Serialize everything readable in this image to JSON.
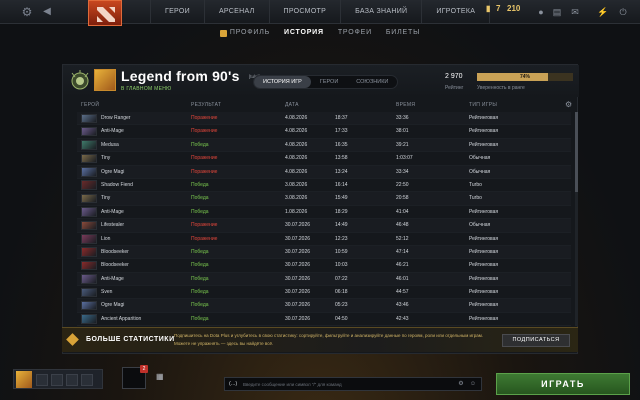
{
  "topbar": {
    "nav": [
      "ГЕРОИ",
      "АРСЕНАЛ",
      "ПРОСМОТР",
      "БАЗА ЗНАНИЙ",
      "ИГРОТЕКА"
    ],
    "shards": "7",
    "gold": "210"
  },
  "subtabs": [
    "ПРОФИЛЬ",
    "ИСТОРИЯ",
    "ТРОФЕИ",
    "БИЛЕТЫ"
  ],
  "profile": {
    "name": "Legend from 90's",
    "tag": "[tulpl]",
    "status": "В ГЛАВНОМ МЕНЮ",
    "tabs": [
      "ИСТОРИЯ ИГР",
      "ГЕРОИ",
      "СОЮЗНИКИ"
    ],
    "rating_value": "2 970",
    "rating_label": "Рейтинг",
    "confidence_pct": "74%",
    "confidence_value": 0.74,
    "confidence_label": "Уверенность в ранге"
  },
  "columns": [
    "ГЕРОЙ",
    "РЕЗУЛЬТАТ",
    "ДАТА",
    "ВРЕМЯ",
    "ТИП ИГРЫ"
  ],
  "matches": [
    {
      "hero": "Drow Ranger",
      "result": "Поражение",
      "win": false,
      "date": "4.08.2026",
      "time": "18:37",
      "duration": "33:36",
      "type": "Рейтинговая",
      "color": "#5b6f8a"
    },
    {
      "hero": "Anti-Mage",
      "result": "Поражение",
      "win": false,
      "date": "4.08.2026",
      "time": "17:33",
      "duration": "38:01",
      "type": "Рейтинговая",
      "color": "#6a5a8a"
    },
    {
      "hero": "Medusa",
      "result": "Победа",
      "win": true,
      "date": "4.08.2026",
      "time": "16:35",
      "duration": "39:21",
      "type": "Рейтинговая",
      "color": "#3f7a6a"
    },
    {
      "hero": "Tiny",
      "result": "Поражение",
      "win": false,
      "date": "4.08.2026",
      "time": "13:58",
      "duration": "1:03:07",
      "type": "Обычная",
      "color": "#7a6a4a"
    },
    {
      "hero": "Ogre Magi",
      "result": "Поражение",
      "win": false,
      "date": "4.08.2026",
      "time": "13:24",
      "duration": "33:34",
      "type": "Обычная",
      "color": "#5a6fa0"
    },
    {
      "hero": "Shadow Fiend",
      "result": "Победа",
      "win": true,
      "date": "3.08.2026",
      "time": "16:14",
      "duration": "22:50",
      "type": "Turbo",
      "color": "#6a2a2a"
    },
    {
      "hero": "Tiny",
      "result": "Победа",
      "win": true,
      "date": "3.08.2026",
      "time": "15:49",
      "duration": "20:58",
      "type": "Turbo",
      "color": "#7a6a4a"
    },
    {
      "hero": "Anti-Mage",
      "result": "Победа",
      "win": true,
      "date": "1.08.2026",
      "time": "18:29",
      "duration": "41:04",
      "type": "Рейтинговая",
      "color": "#6a5a8a"
    },
    {
      "hero": "Lifestealer",
      "result": "Поражение",
      "win": false,
      "date": "30.07.2026",
      "time": "14:49",
      "duration": "46:48",
      "type": "Обычная",
      "color": "#8a4a3a"
    },
    {
      "hero": "Lion",
      "result": "Поражение",
      "win": false,
      "date": "30.07.2026",
      "time": "12:23",
      "duration": "52:12",
      "type": "Рейтинговая",
      "color": "#7a3a5a"
    },
    {
      "hero": "Bloodseeker",
      "result": "Победа",
      "win": true,
      "date": "30.07.2026",
      "time": "10:59",
      "duration": "47:14",
      "type": "Рейтинговая",
      "color": "#8a2a2a"
    },
    {
      "hero": "Bloodseeker",
      "result": "Победа",
      "win": true,
      "date": "30.07.2026",
      "time": "10:03",
      "duration": "46:21",
      "type": "Рейтинговая",
      "color": "#8a2a2a"
    },
    {
      "hero": "Anti-Mage",
      "result": "Победа",
      "win": true,
      "date": "30.07.2026",
      "time": "07:22",
      "duration": "46:01",
      "type": "Рейтинговая",
      "color": "#6a5a8a"
    },
    {
      "hero": "Sven",
      "result": "Победа",
      "win": true,
      "date": "30.07.2026",
      "time": "06:18",
      "duration": "44:57",
      "type": "Рейтинговая",
      "color": "#4a5a7a"
    },
    {
      "hero": "Ogre Magi",
      "result": "Победа",
      "win": true,
      "date": "30.07.2026",
      "time": "05:23",
      "duration": "43:46",
      "type": "Рейтинговая",
      "color": "#5a6fa0"
    },
    {
      "hero": "Ancient Apparition",
      "result": "Победа",
      "win": true,
      "date": "30.07.2026",
      "time": "04:50",
      "duration": "42:43",
      "type": "Рейтинговая",
      "color": "#3a6a8a"
    }
  ],
  "plus": {
    "title": "БОЛЬШЕ СТАТИСТИКИ",
    "text": "Подпишитесь на Dota Plus и углубитесь в свою статистику: сортируйте, фильтруйте и анализируйте данные по героям, роли или отдельным играм. Можете не упражнять — здесь вы найдёте всё.",
    "button": "ПОДПИСАТЬСЯ"
  },
  "bottom": {
    "invite_count": "2",
    "chat_prefix": "(...)",
    "chat_placeholder": "Введите сообщение или символ \"/\" для команд",
    "play": "ИГРАТЬ"
  }
}
